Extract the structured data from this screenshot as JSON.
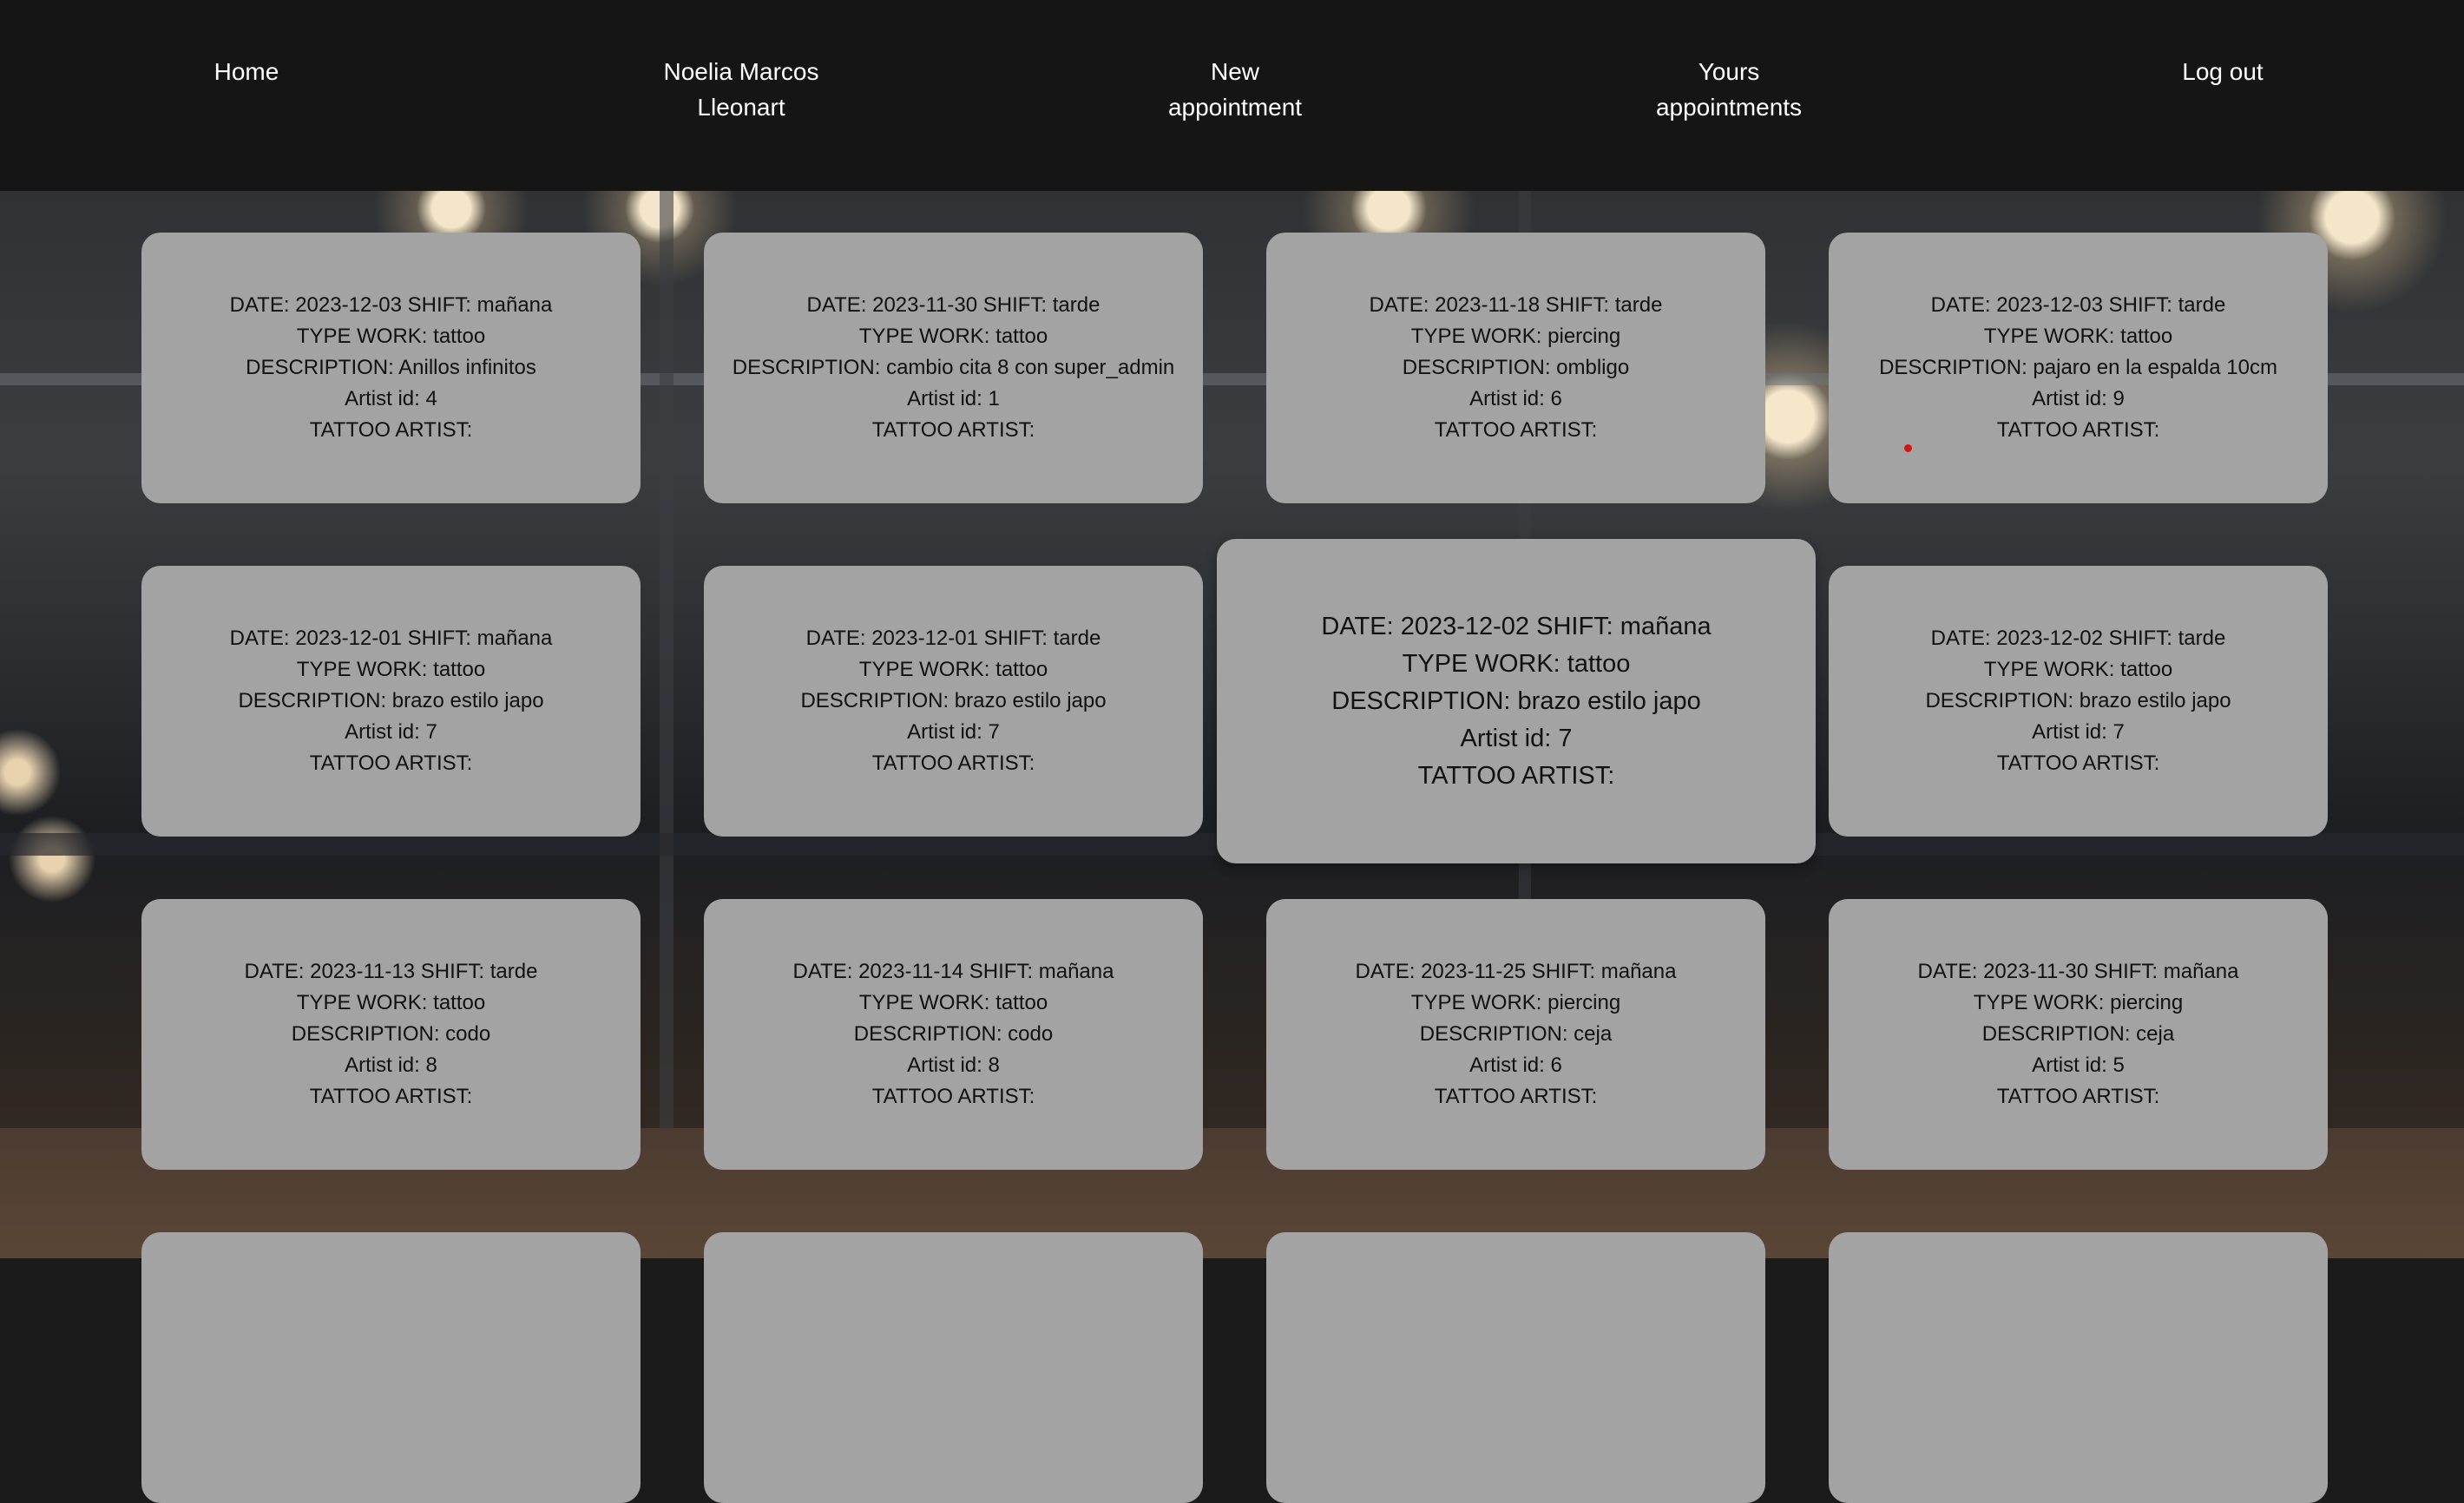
{
  "nav": {
    "home": "Home",
    "user": "Noelia Marcos\nLleonart",
    "new_appointment": "New\nappointment",
    "yours_appointments": "Yours\nappointments",
    "logout": "Log out"
  },
  "labels": {
    "date": "DATE: ",
    "shift": " SHIFT: ",
    "type_work": "TYPE WORK: ",
    "description": "DESCRIPTION: ",
    "artist_id": "Artist id: ",
    "tattoo_artist": "TATTOO ARTIST:"
  },
  "appointments": [
    {
      "date": "2023-12-03",
      "shift": "mañana",
      "type_work": "tattoo",
      "description": "Anillos infinitos",
      "artist_id": "4"
    },
    {
      "date": "2023-11-30",
      "shift": "tarde",
      "type_work": "tattoo",
      "description": "cambio cita 8 con super_admin",
      "artist_id": "1"
    },
    {
      "date": "2023-11-18",
      "shift": "tarde",
      "type_work": "piercing",
      "description": "ombligo",
      "artist_id": "6"
    },
    {
      "date": "2023-12-03",
      "shift": "tarde",
      "type_work": "tattoo",
      "description": "pajaro en la espalda 10cm",
      "artist_id": "9"
    },
    {
      "date": "2023-12-01",
      "shift": "mañana",
      "type_work": "tattoo",
      "description": "brazo estilo japo",
      "artist_id": "7"
    },
    {
      "date": "2023-12-01",
      "shift": "tarde",
      "type_work": "tattoo",
      "description": "brazo estilo japo",
      "artist_id": "7"
    },
    {
      "date": "2023-12-02",
      "shift": "mañana",
      "type_work": "tattoo",
      "description": "brazo estilo japo",
      "artist_id": "7",
      "hovered": true
    },
    {
      "date": "2023-12-02",
      "shift": "tarde",
      "type_work": "tattoo",
      "description": "brazo estilo japo",
      "artist_id": "7"
    },
    {
      "date": "2023-11-13",
      "shift": "tarde",
      "type_work": "tattoo",
      "description": "codo",
      "artist_id": "8"
    },
    {
      "date": "2023-11-14",
      "shift": "mañana",
      "type_work": "tattoo",
      "description": "codo",
      "artist_id": "8"
    },
    {
      "date": "2023-11-25",
      "shift": "mañana",
      "type_work": "piercing",
      "description": "ceja",
      "artist_id": "6"
    },
    {
      "date": "2023-11-30",
      "shift": "mañana",
      "type_work": "piercing",
      "description": "ceja",
      "artist_id": "5"
    }
  ],
  "partial_cards_count": 4,
  "colors": {
    "navbar": "#151515",
    "card": "#a3a3a3",
    "nav_text": "#ffffff",
    "card_text": "#111111"
  }
}
